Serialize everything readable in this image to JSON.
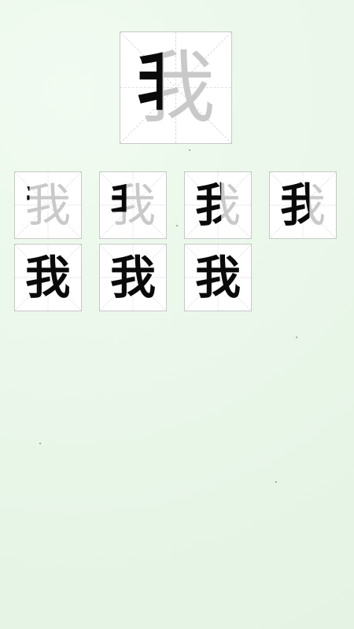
{
  "character": {
    "glyph": "我"
  },
  "stroke_steps": [
    {
      "label": "我"
    },
    {
      "label": "我"
    },
    {
      "label": "我"
    },
    {
      "label": "我"
    },
    {
      "label": "我"
    },
    {
      "label": "我"
    },
    {
      "label": "我"
    }
  ],
  "colors": {
    "background": "#eaf7ea",
    "cell_background": "#ffffff",
    "cell_border": "#c8c8c8",
    "guide_lines": "#d3d3d3",
    "ghost_glyph": "#c9c9c9",
    "ink_glyph": "#0a0a0a"
  },
  "icons": {
    "grid": "tianzige-guide-grid"
  }
}
